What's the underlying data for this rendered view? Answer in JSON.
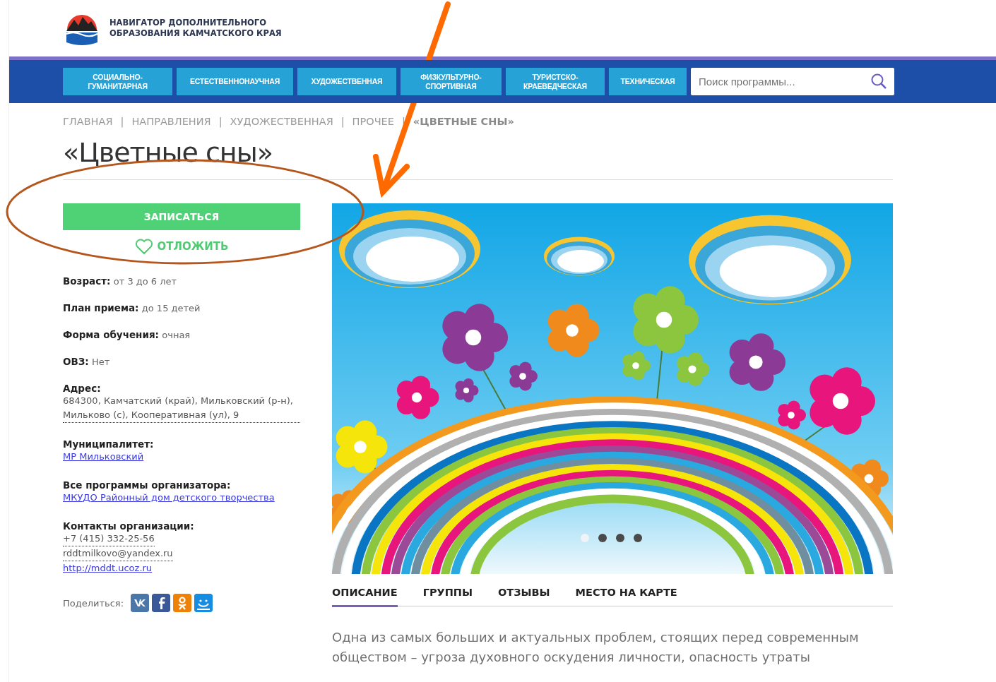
{
  "header": {
    "title_line_1": "НАВИГАТОР ДОПОЛНИТЕЛЬНОГО",
    "title_line_2": "ОБРАЗОВАНИЯ КАМЧАТСКОГО КРАЯ"
  },
  "nav": [
    {
      "label": "СОЦИАЛЬНО-ГУМАНИТАРНАЯ",
      "selected": false
    },
    {
      "label": "ЕСТЕСТВЕННОНАУЧНАЯ",
      "selected": false
    },
    {
      "label": "ХУДОЖЕСТВЕННАЯ",
      "selected": false
    },
    {
      "label": "ФИЗКУЛЬТУРНО-СПОРТИВНАЯ",
      "selected": false
    },
    {
      "label": "ТУРИСТСКО-КРАЕВЕДЧЕСКАЯ",
      "selected": false
    },
    {
      "label": "ТЕХНИЧЕСКАЯ",
      "selected": false
    }
  ],
  "search": {
    "placeholder": "Поиск программы..."
  },
  "breadcrumbs": [
    {
      "kind": "link",
      "text": "ГЛАВНАЯ"
    },
    {
      "kind": "separator",
      "text": "|"
    },
    {
      "kind": "link",
      "text": "НАПРАВЛЕНИЯ"
    },
    {
      "kind": "separator",
      "text": "|"
    },
    {
      "kind": "link",
      "text": "ХУДОЖЕСТВЕННАЯ"
    },
    {
      "kind": "separator",
      "text": "|"
    },
    {
      "kind": "link",
      "text": "ПРОЧЕЕ"
    },
    {
      "kind": "separator",
      "text": "|"
    },
    {
      "kind": "current",
      "text": "«ЦВЕТНЫЕ СНЫ»"
    }
  ],
  "title": "«Цветные сны»",
  "enroll_button": "ЗАПИСАТЬСЯ",
  "postpone_button": "ОТЛОЖИТЬ",
  "fields": [
    {
      "label": "Возраст:",
      "kind": "inline",
      "values": [
        {
          "kind": "text",
          "text": "от 3 до 6 лет"
        }
      ]
    },
    {
      "label": "План приема:",
      "kind": "inline",
      "values": [
        {
          "kind": "text",
          "text": "до 15 детей"
        }
      ]
    },
    {
      "label": "Форма обучения:",
      "kind": "inline",
      "values": [
        {
          "kind": "text",
          "text": "очная"
        }
      ]
    },
    {
      "label": "ОВЗ:",
      "kind": "inline",
      "values": [
        {
          "kind": "text",
          "text": "Нет"
        }
      ]
    },
    {
      "label": "Адрес:",
      "kind": "block",
      "values": [
        {
          "kind": "dotted",
          "text": "684300, Камчатский (край), Мильковский (р-н), Мильково (с), Кооперативная (ул), 9"
        }
      ]
    },
    {
      "label": "Муниципалитет:",
      "kind": "block",
      "values": [
        {
          "kind": "link",
          "text": "МР Мильковский"
        }
      ]
    },
    {
      "label": "Все программы организатора:",
      "kind": "block",
      "values": [
        {
          "kind": "link",
          "text": "МКУДО Районный дом детского творчества"
        }
      ]
    },
    {
      "label": "Контакты организации:",
      "kind": "block",
      "values": [
        {
          "kind": "dotted",
          "text": "+7 (415) 332-25-56"
        },
        {
          "kind": "dotted",
          "text": "rddtmilkovo@yandex.ru"
        },
        {
          "kind": "link",
          "text": "http://mddt.ucoz.ru"
        }
      ]
    }
  ],
  "share": {
    "label": "Поделиться:",
    "buttons": [
      {
        "color": "#4a76a8"
      },
      {
        "color": "#3b5998"
      },
      {
        "color": "#ee8208"
      },
      {
        "color": "#168de2"
      }
    ]
  },
  "carousel_dots": [
    {
      "selected": true
    },
    {
      "selected": false
    },
    {
      "selected": false
    },
    {
      "selected": false
    }
  ],
  "tabs": [
    {
      "label": "ОПИСАНИЕ",
      "selected": true
    },
    {
      "label": "ГРУППЫ",
      "selected": false
    },
    {
      "label": "ОТЗЫВЫ",
      "selected": false
    },
    {
      "label": "МЕСТО НА КАРТЕ",
      "selected": false
    }
  ],
  "description": "Одна из самых больших и актуальных проблем, стоящих перед современным обществом – угроза духовного оскудения личности, опасность утраты"
}
